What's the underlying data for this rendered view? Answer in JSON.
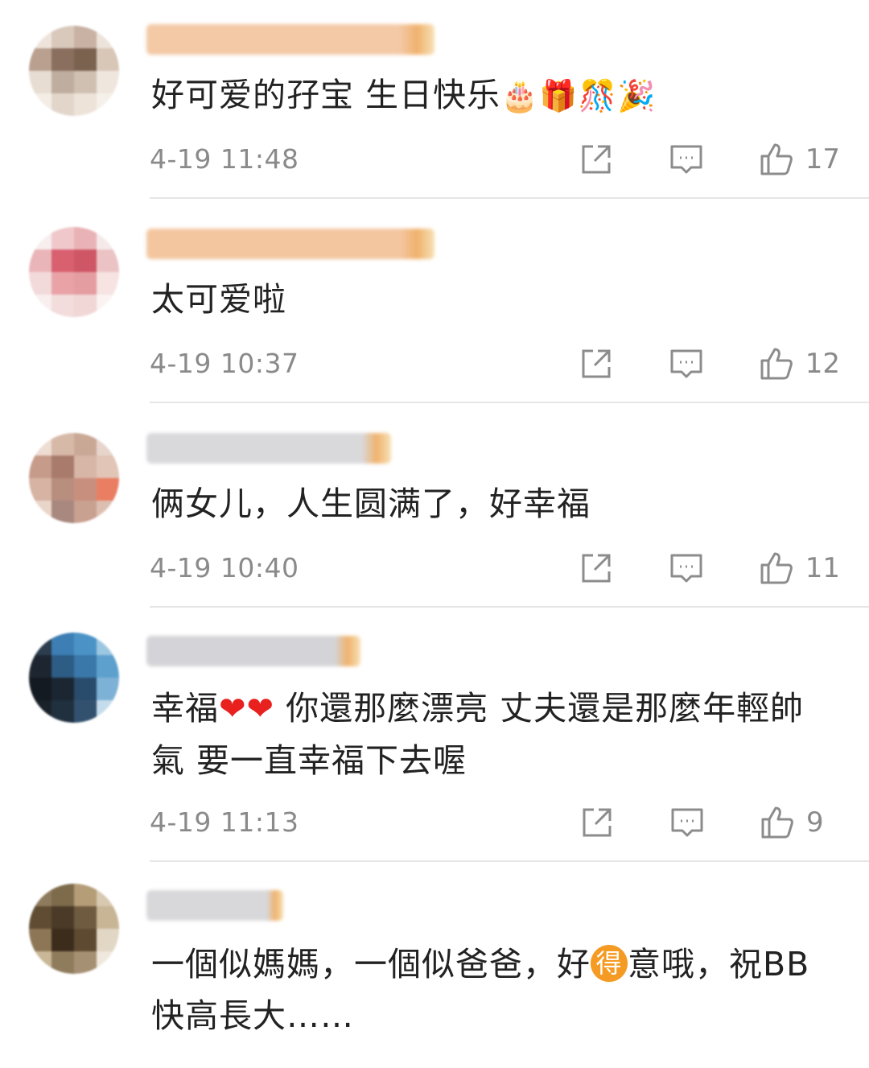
{
  "comments": [
    {
      "text": "好可爱的孖宝 生日快乐",
      "emojis": "🎂🎁🎊🎉",
      "time": "4-19 11:48",
      "likes": "17",
      "avatar_colors": [
        "#efe4dc",
        "#d9c9bc",
        "#c9b2a4",
        "#ece3da",
        "#b9a08f",
        "#8a6f5e",
        "#7b624f",
        "#d8c6b7",
        "#e8ddd3",
        "#bfae9f",
        "#d0c0b2",
        "#efe6de",
        "#f4ede6",
        "#e2d6cb",
        "#ede3d9",
        "#f6f0ea"
      ],
      "username_color": "#f3c9a6"
    },
    {
      "text": "太可爱啦",
      "time": "4-19 10:37",
      "likes": "12",
      "avatar_colors": [
        "#f7eeee",
        "#f0c8cc",
        "#e9b3b6",
        "#f6e9ea",
        "#eab5b9",
        "#d9606f",
        "#cf5765",
        "#ecc3c5",
        "#f3dada",
        "#e9a3a7",
        "#e49da0",
        "#f6e3e2",
        "#f8efee",
        "#f2dcdc",
        "#f1d7d6",
        "#faf3f2"
      ],
      "username_color": "#f4c6a0"
    },
    {
      "text": "俩女儿，人生圆满了，好幸福",
      "time": "4-19 10:40",
      "likes": "11",
      "avatar_colors": [
        "#eeddd2",
        "#d7b9a8",
        "#caa896",
        "#e7d5cb",
        "#c69b89",
        "#a87b6c",
        "#d8b6a7",
        "#e1c5b6",
        "#d6b3a2",
        "#b88e7f",
        "#c98f7e",
        "#e97e62",
        "#e9d5c9",
        "#a9887f",
        "#c9a191",
        "#ddbfb1"
      ],
      "username_color": "#d9d9dc"
    },
    {
      "text_parts": [
        "幸福",
        "❤❤",
        " 你還那麼漂亮 丈夫還是那麼年輕帥氣 要一直幸福下去喔"
      ],
      "time": "4-19 11:13",
      "likes": "9",
      "avatar_colors": [
        "#2b3d4f",
        "#3d7fb4",
        "#4b93c6",
        "#9cc7e1",
        "#1d2530",
        "#2d5c84",
        "#3978a8",
        "#5ea0cd",
        "#141a22",
        "#1c2632",
        "#2a4c6c",
        "#7eb1d6",
        "#1a2129",
        "#20303f",
        "#32516f",
        "#c4dcec"
      ],
      "username_color": "#d4d4d8"
    },
    {
      "text_parts": [
        "一個似媽媽，一個似爸爸，好",
        "得",
        "意哦，祝BB快高長大……"
      ],
      "avatar_colors": [
        "#8e7a5c",
        "#7d6b4b",
        "#b59d78",
        "#d7c8b0",
        "#5f4c33",
        "#4a3a27",
        "#6f5b3f",
        "#c7b596",
        "#8d7655",
        "#3b2c1c",
        "#5e4a31",
        "#e2d7c5",
        "#c9b797",
        "#8f7c5d",
        "#a69073",
        "#f0e8dc"
      ],
      "username_color": "#d8d8da"
    }
  ],
  "icons": {
    "share": "share-icon",
    "reply": "comment-icon",
    "like": "thumbs-up-icon"
  }
}
